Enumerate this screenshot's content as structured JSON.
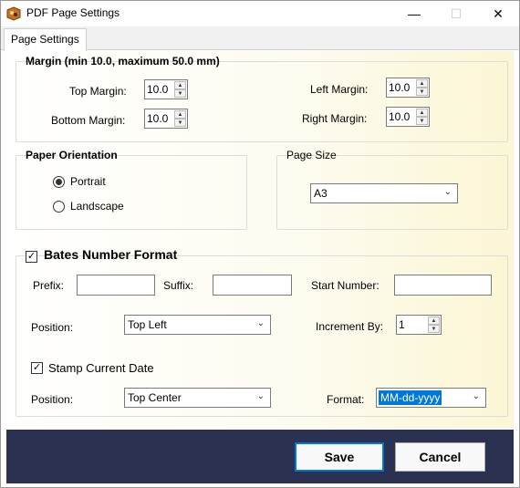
{
  "window": {
    "title": "PDF Page Settings",
    "minimize_label": "—",
    "maximize_label": "☐",
    "close_label": "✕"
  },
  "tabs": [
    {
      "label": "Page Settings",
      "selected": true
    }
  ],
  "margin": {
    "title": "Margin (min 10.0, maximum 50.0 mm)",
    "top_label": "Top Margin:",
    "top_value": "10.0",
    "bottom_label": "Bottom Margin:",
    "bottom_value": "10.0",
    "left_label": "Left Margin:",
    "left_value": "10.0",
    "right_label": "Right Margin:",
    "right_value": "10.0"
  },
  "orientation": {
    "title": "Paper Orientation",
    "options": [
      {
        "label": "Portrait",
        "checked": true
      },
      {
        "label": "Landscape",
        "checked": false
      }
    ]
  },
  "page_size": {
    "title": "Page Size",
    "value": "A3"
  },
  "bates": {
    "enabled": true,
    "title": "Bates Number Format",
    "prefix_label": "Prefix:",
    "prefix_value": "",
    "suffix_label": "Suffix:",
    "suffix_value": "",
    "start_label": "Start Number:",
    "start_value": "",
    "position_label": "Position:",
    "position_value": "Top Left",
    "increment_label": "Increment By:",
    "increment_value": "1",
    "stamp_date": {
      "enabled": true,
      "label": "Stamp Current Date",
      "position_label": "Position:",
      "position_value": "Top Center",
      "format_label": "Format:",
      "format_value": "MM-dd-yyyy"
    }
  },
  "footer": {
    "save_label": "Save",
    "cancel_label": "Cancel"
  },
  "colors": {
    "footer_bg": "#2b3150",
    "accent": "#0078d7",
    "content_gradient_end": "#fbf6d4"
  }
}
